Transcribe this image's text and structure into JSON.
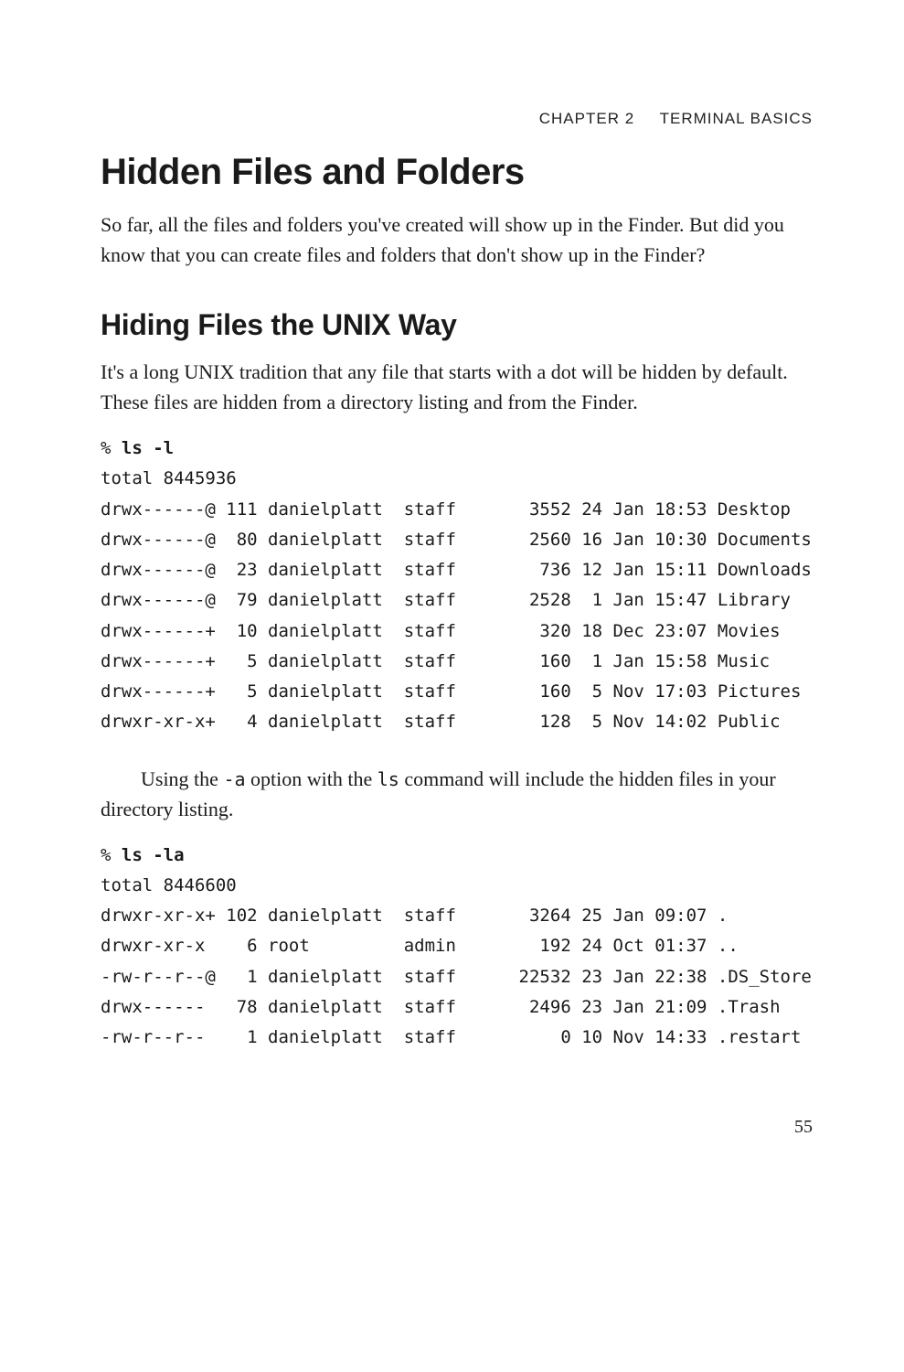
{
  "header": {
    "chapter": "CHAPTER 2",
    "title": "TERMINAL BASICS"
  },
  "h1": "Hidden Files and Folders",
  "para1": "So far, all the files and folders you've created will show up in the Finder. But did you know that you can create files and folders that don't show up in the Finder?",
  "h2": "Hiding Files the UNIX Way",
  "para2": "It's a long UNIX tradition that any file that starts with a dot will be hidden by default. These files are hidden from a directory listing and from the Finder.",
  "cmd1_prompt": "% ",
  "cmd1": "ls -l",
  "listing1": [
    "total 8445936",
    "drwx------@ 111 danielplatt  staff       3552 24 Jan 18:53 Desktop",
    "drwx------@  80 danielplatt  staff       2560 16 Jan 10:30 Documents",
    "drwx------@  23 danielplatt  staff        736 12 Jan 15:11 Downloads",
    "drwx------@  79 danielplatt  staff       2528  1 Jan 15:47 Library",
    "drwx------+  10 danielplatt  staff        320 18 Dec 23:07 Movies",
    "drwx------+   5 danielplatt  staff        160  1 Jan 15:58 Music",
    "drwx------+   5 danielplatt  staff        160  5 Nov 17:03 Pictures",
    "drwxr-xr-x+   4 danielplatt  staff        128  5 Nov 14:02 Public"
  ],
  "para3_pre": "Using the ",
  "para3_code1": "-a",
  "para3_mid": " option with the ",
  "para3_code2": "ls",
  "para3_post": " command will include the hidden files in your directory listing.",
  "cmd2_prompt": "% ",
  "cmd2": "ls -la",
  "listing2": [
    "total 8446600",
    "drwxr-xr-x+ 102 danielplatt  staff       3264 25 Jan 09:07 .",
    "drwxr-xr-x    6 root         admin        192 24 Oct 01:37 ..",
    "-rw-r--r--@   1 danielplatt  staff      22532 23 Jan 22:38 .DS_Store",
    "drwx------   78 danielplatt  staff       2496 23 Jan 21:09 .Trash",
    "-rw-r--r--    1 danielplatt  staff          0 10 Nov 14:33 .restart"
  ],
  "page_number": "55"
}
